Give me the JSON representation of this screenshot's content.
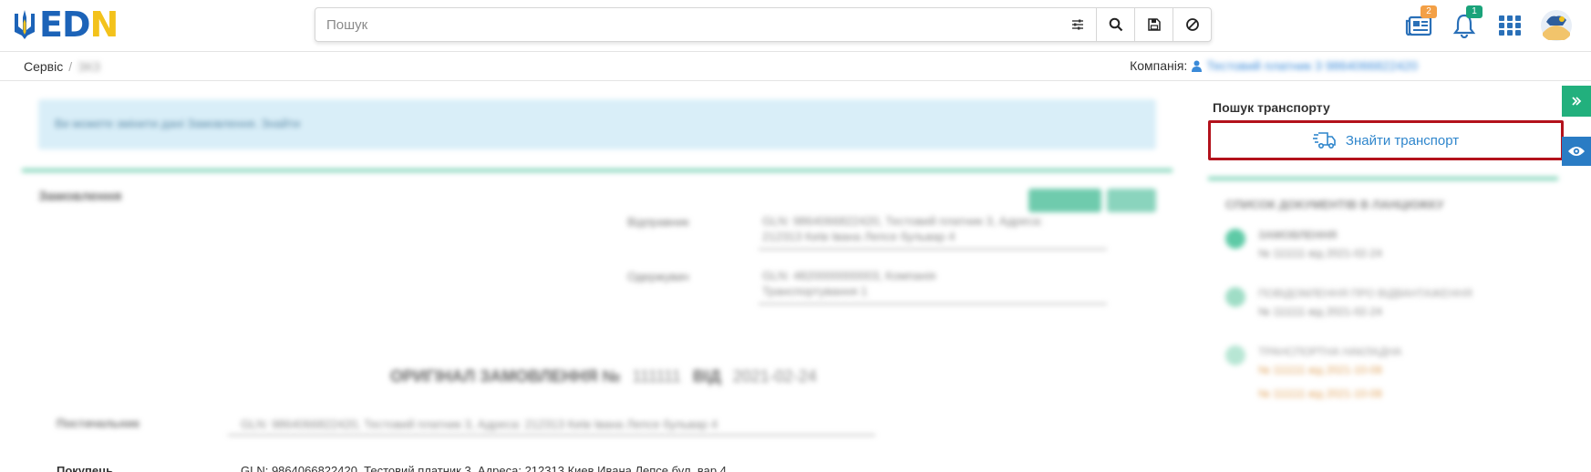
{
  "header": {
    "logo_text_a": "ED",
    "logo_text_b": "N",
    "search_placeholder": "Пошук",
    "news_badge": "2",
    "notifications_badge": "1"
  },
  "breadcrumb": {
    "root": "Сервіс",
    "separator": "/",
    "current": "ЗКЗ"
  },
  "company": {
    "label": "Компанія:",
    "value": "Тестовий платник 3 9864066822420"
  },
  "main": {
    "info_text": "Ви можете змінити дані Замовлення. Знайти",
    "card_title": "Замовлення",
    "consignee_label": "Відправник",
    "consignee_value_line1": "GLN: 9864066822420, Тестовий платник 3, Адреса:",
    "consignee_value_line2": "212313 Київ Івана Лепсе бульвар 4",
    "consignor_label": "Одержувач",
    "consignor_value_line1": "GLN: 4820000000003, Компанія",
    "consignor_value_line2": "Транспортування 1",
    "order_title": "ОРИГІНАЛ ЗАМОВЛЕННЯ №",
    "order_number": "111111",
    "order_from": "ВІД",
    "order_date": "2021-02-24",
    "supplier_label": "Постачальник",
    "supplier_value": "GLN: 9864066822420, Тестовий платник 3, Адреса: 212313 Київ Івана Лепсе бульвар 4",
    "buyer_label": "Покупець",
    "buyer_value": "GLN: 9864066822420, Тестовий платник 3, Адреса: 212313 Киев Ивана Лепсе бул. вар 4"
  },
  "right_panel": {
    "title": "Пошук транспорту",
    "find_button": "Знайти транспорт",
    "chain_title": "СПИСОК ДОКУМЕНТІВ В ЛАНЦЮЖКУ",
    "steps": [
      {
        "title": "ЗАМОВЛЕННЯ",
        "sub": "№ 111111 від 2021-02-24"
      },
      {
        "title": "ПОВІДОМЛЕННЯ ПРО ВІДВАНТАЖЕННЯ",
        "sub": "№ 111111 від 2021-02-24"
      },
      {
        "title": "ТРАНСПОРТНА НАКЛАДНА",
        "sub": "№ 111111 від 2021-10-08"
      },
      {
        "title": "",
        "sub": "№ 111111 від 2021-10-08"
      }
    ]
  },
  "colors": {
    "brand_blue": "#1c63b8",
    "brand_yellow": "#f3c21b",
    "accent_teal": "#22b07d",
    "highlight_red": "#b3121c",
    "link_blue": "#2f86cc"
  }
}
